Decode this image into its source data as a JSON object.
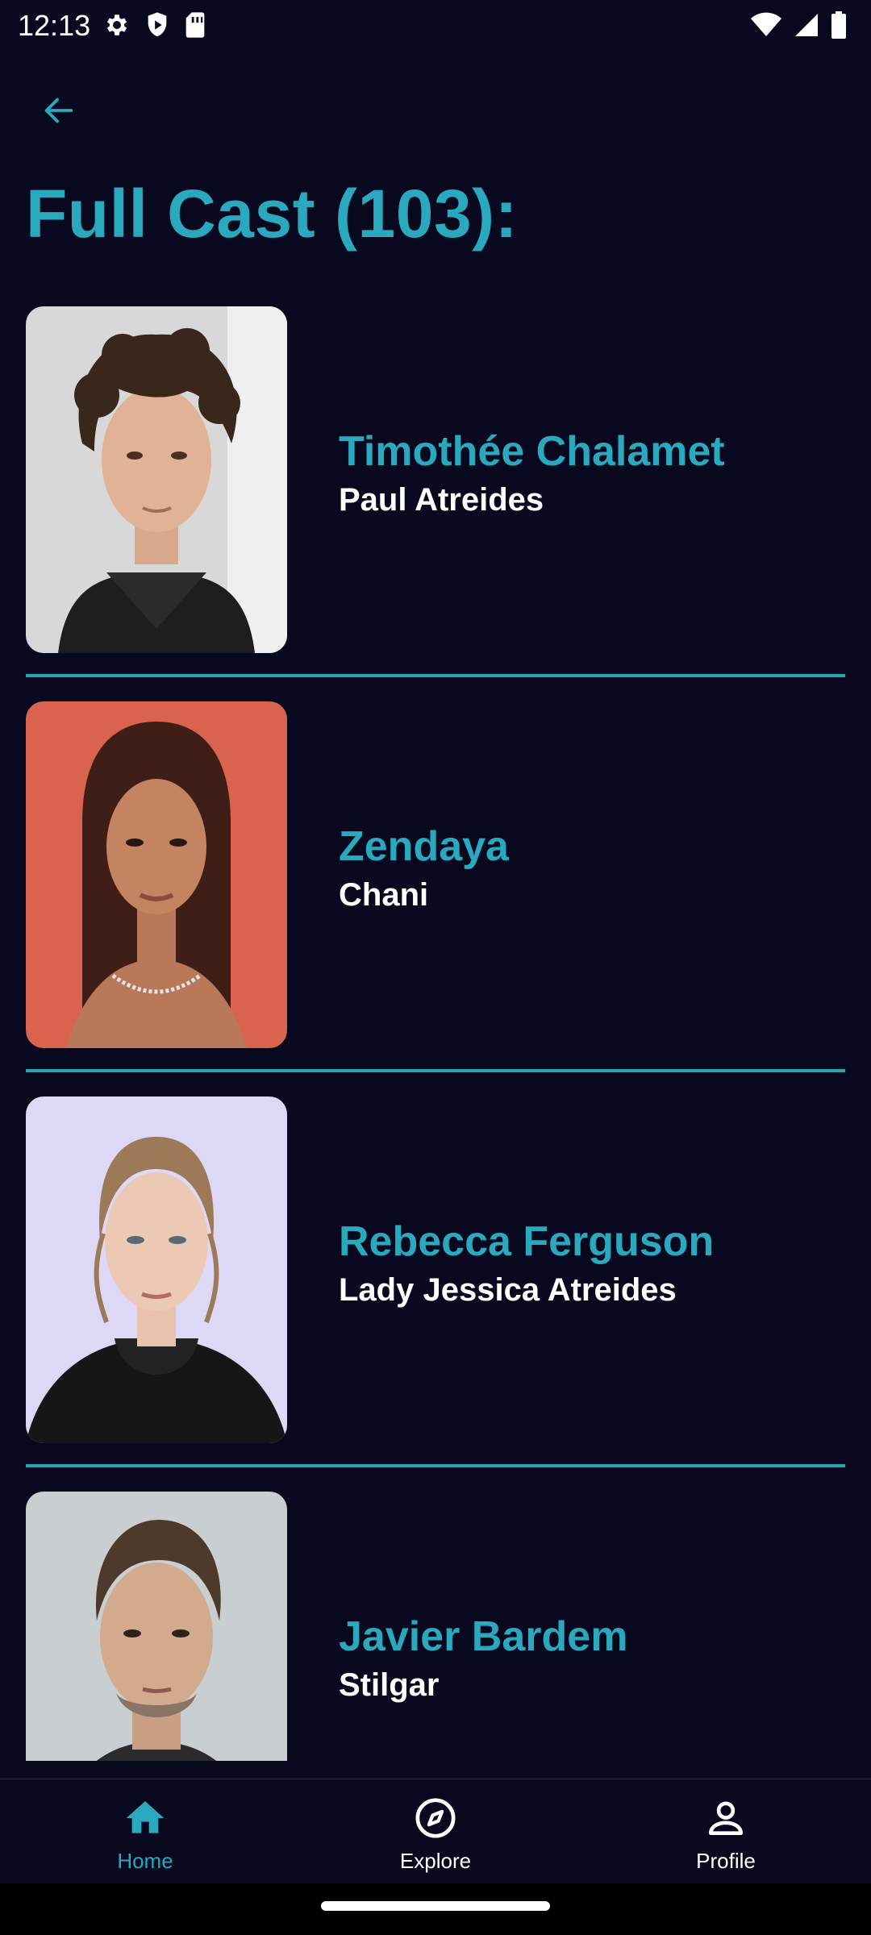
{
  "status_bar": {
    "time": "12:13",
    "left_icons": [
      "settings-icon",
      "shield-icon",
      "sim-card-icon"
    ],
    "right_icons": [
      "wifi-icon",
      "signal-icon",
      "battery-icon"
    ]
  },
  "header": {
    "back_icon": "arrow-left-icon",
    "title": "Full Cast (103):"
  },
  "cast": [
    {
      "name": "Timothée Chalamet",
      "role": "Paul Atreides"
    },
    {
      "name": "Zendaya",
      "role": "Chani"
    },
    {
      "name": "Rebecca Ferguson",
      "role": "Lady Jessica Atreides"
    },
    {
      "name": "Javier Bardem",
      "role": "Stilgar"
    }
  ],
  "bottom_nav": {
    "items": [
      {
        "label": "Home",
        "icon": "home-icon",
        "active": true
      },
      {
        "label": "Explore",
        "icon": "compass-icon",
        "active": false
      },
      {
        "label": "Profile",
        "icon": "person-icon",
        "active": false
      }
    ]
  },
  "colors": {
    "background": "#08081f",
    "accent": "#2aa8bd",
    "text": "#ffffff"
  }
}
